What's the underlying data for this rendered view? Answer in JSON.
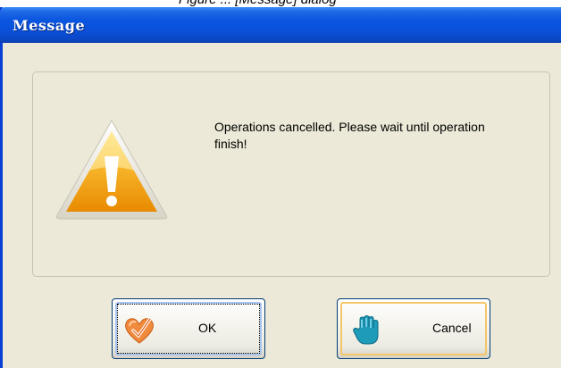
{
  "header_caption": "Figure ... [Message] dialog",
  "dialog": {
    "title": "Message",
    "message": "Operations cancelled. Please wait until operation finish!",
    "icon": "warning-icon"
  },
  "buttons": {
    "ok": {
      "label": "OK",
      "icon": "heart-check-icon"
    },
    "cancel": {
      "label": "Cancel",
      "icon": "hand-stop-icon"
    }
  },
  "colors": {
    "titlebar": "#0a56df",
    "window_bg": "#ece9d8",
    "ok_focus": "#a9c5f2",
    "cancel_hover": "#f4c66a",
    "warning_fill": "#f5a800"
  }
}
